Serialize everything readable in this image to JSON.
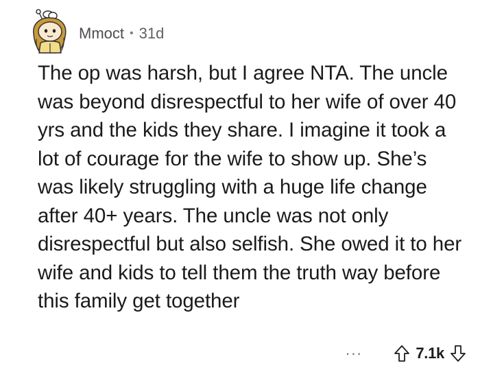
{
  "comment": {
    "author": "Mmoct",
    "separator": "•",
    "age": "31d",
    "body": "The op was harsh, but I agree NTA. The uncle was beyond disrespectful to her wife of over 40 yrs and the kids they share. I imagine it took a lot of courage for the wife to show up. She’s was likely struggling with a huge life change after 40+ years. The uncle was not only disrespectful but also selfish. She owed it to her wife and kids to tell them the truth way before this family get together"
  },
  "actions": {
    "more_label": "···",
    "score": "7.1k",
    "upvote_icon": "upvote-arrow-icon",
    "downvote_icon": "downvote-arrow-icon"
  },
  "avatar": {
    "icon": "snoo-avatar-icon",
    "hair_color": "#c89a3a",
    "skin_color": "#fbe9cf"
  }
}
